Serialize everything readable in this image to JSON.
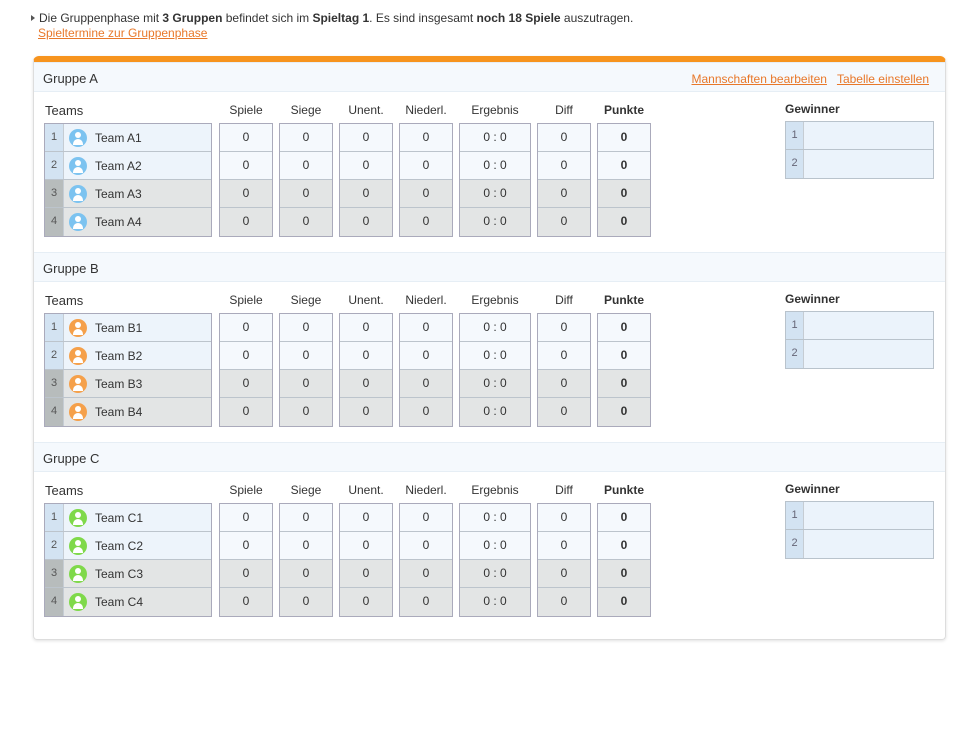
{
  "intro": {
    "parts": [
      "Die Gruppenphase mit ",
      "3 Gruppen",
      " befindet sich im ",
      "Spieltag 1",
      ". Es sind insgesamt ",
      "noch 18 Spiele",
      " auszutragen."
    ],
    "link": "Spieltermine zur Gruppenphase"
  },
  "header_links": {
    "edit_teams": "Mannschaften bearbeiten",
    "table_settings": "Tabelle einstellen"
  },
  "columns": {
    "teams": "Teams",
    "spiele": "Spiele",
    "siege": "Siege",
    "unent": "Unent.",
    "niederl": "Niederl.",
    "ergebnis": "Ergebnis",
    "diff": "Diff",
    "punkte": "Punkte",
    "gewinner": "Gewinner"
  },
  "groups": [
    {
      "name": "Gruppe A",
      "color": "#7cc3f0",
      "teams": [
        {
          "rank": "1",
          "name": "Team A1",
          "spiele": "0",
          "siege": "0",
          "unent": "0",
          "niederl": "0",
          "ergebnis": "0 : 0",
          "diff": "0",
          "punkte": "0"
        },
        {
          "rank": "2",
          "name": "Team A2",
          "spiele": "0",
          "siege": "0",
          "unent": "0",
          "niederl": "0",
          "ergebnis": "0 : 0",
          "diff": "0",
          "punkte": "0"
        },
        {
          "rank": "3",
          "name": "Team A3",
          "spiele": "0",
          "siege": "0",
          "unent": "0",
          "niederl": "0",
          "ergebnis": "0 : 0",
          "diff": "0",
          "punkte": "0"
        },
        {
          "rank": "4",
          "name": "Team A4",
          "spiele": "0",
          "siege": "0",
          "unent": "0",
          "niederl": "0",
          "ergebnis": "0 : 0",
          "diff": "0",
          "punkte": "0"
        }
      ],
      "winners": [
        "1",
        "2"
      ]
    },
    {
      "name": "Gruppe B",
      "color": "#f5a04a",
      "teams": [
        {
          "rank": "1",
          "name": "Team B1",
          "spiele": "0",
          "siege": "0",
          "unent": "0",
          "niederl": "0",
          "ergebnis": "0 : 0",
          "diff": "0",
          "punkte": "0"
        },
        {
          "rank": "2",
          "name": "Team B2",
          "spiele": "0",
          "siege": "0",
          "unent": "0",
          "niederl": "0",
          "ergebnis": "0 : 0",
          "diff": "0",
          "punkte": "0"
        },
        {
          "rank": "3",
          "name": "Team B3",
          "spiele": "0",
          "siege": "0",
          "unent": "0",
          "niederl": "0",
          "ergebnis": "0 : 0",
          "diff": "0",
          "punkte": "0"
        },
        {
          "rank": "4",
          "name": "Team B4",
          "spiele": "0",
          "siege": "0",
          "unent": "0",
          "niederl": "0",
          "ergebnis": "0 : 0",
          "diff": "0",
          "punkte": "0"
        }
      ],
      "winners": [
        "1",
        "2"
      ]
    },
    {
      "name": "Gruppe C",
      "color": "#7fd94a",
      "teams": [
        {
          "rank": "1",
          "name": "Team C1",
          "spiele": "0",
          "siege": "0",
          "unent": "0",
          "niederl": "0",
          "ergebnis": "0 : 0",
          "diff": "0",
          "punkte": "0"
        },
        {
          "rank": "2",
          "name": "Team C2",
          "spiele": "0",
          "siege": "0",
          "unent": "0",
          "niederl": "0",
          "ergebnis": "0 : 0",
          "diff": "0",
          "punkte": "0"
        },
        {
          "rank": "3",
          "name": "Team C3",
          "spiele": "0",
          "siege": "0",
          "unent": "0",
          "niederl": "0",
          "ergebnis": "0 : 0",
          "diff": "0",
          "punkte": "0"
        },
        {
          "rank": "4",
          "name": "Team C4",
          "spiele": "0",
          "siege": "0",
          "unent": "0",
          "niederl": "0",
          "ergebnis": "0 : 0",
          "diff": "0",
          "punkte": "0"
        }
      ],
      "winners": [
        "1",
        "2"
      ]
    }
  ]
}
